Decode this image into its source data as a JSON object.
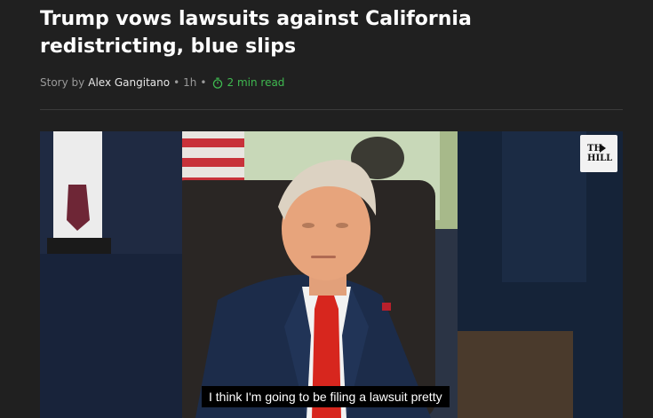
{
  "article": {
    "headline": "Trump vows lawsuits against California redistricting, blue slips",
    "byline_prefix": "Story by",
    "author": "Alex Gangitano",
    "age": "1h",
    "read_time": "2 min read"
  },
  "video": {
    "logo_line1": "TH",
    "logo_line2": "HILL",
    "caption": "I think I'm going to be filing a lawsuit pretty"
  },
  "colors": {
    "background": "#202020",
    "read_time": "#3fb950",
    "tie": "#d7261e",
    "suit": "#1c2c4a"
  },
  "icons": [
    "timer-icon",
    "play-icon"
  ]
}
